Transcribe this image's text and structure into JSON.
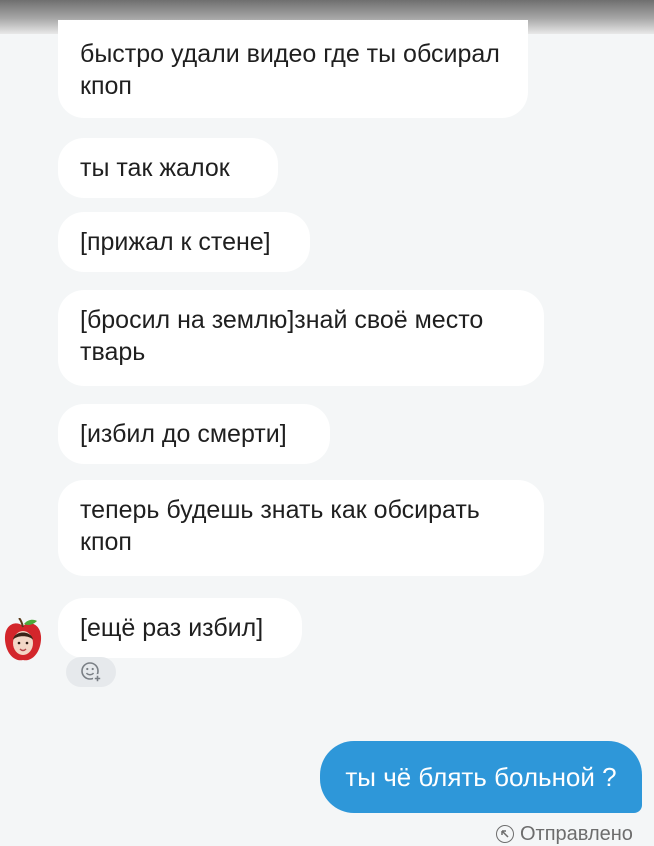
{
  "messages": [
    {
      "text": "быстро удали видео где ты обсирал кпоп"
    },
    {
      "text": "ты так жалок"
    },
    {
      "text": "[прижал к стене]"
    },
    {
      "text": "[бросил на землю]знай своё место тварь"
    },
    {
      "text": "[избил до смерти]"
    },
    {
      "text": "теперь будешь знать как обсирать кпоп"
    },
    {
      "text": "[ещё раз избил]"
    }
  ],
  "outgoing": {
    "text": "ты чё блять больной ?"
  },
  "status": {
    "label": "Отправлено",
    "icon": "sent-icon"
  },
  "icons": {
    "reaction": "emoji-add-icon",
    "avatar": "apple-avatar"
  },
  "colors": {
    "outgoing_bubble": "#2e97d9",
    "incoming_bubble": "#ffffff",
    "background": "#f4f6f7"
  }
}
